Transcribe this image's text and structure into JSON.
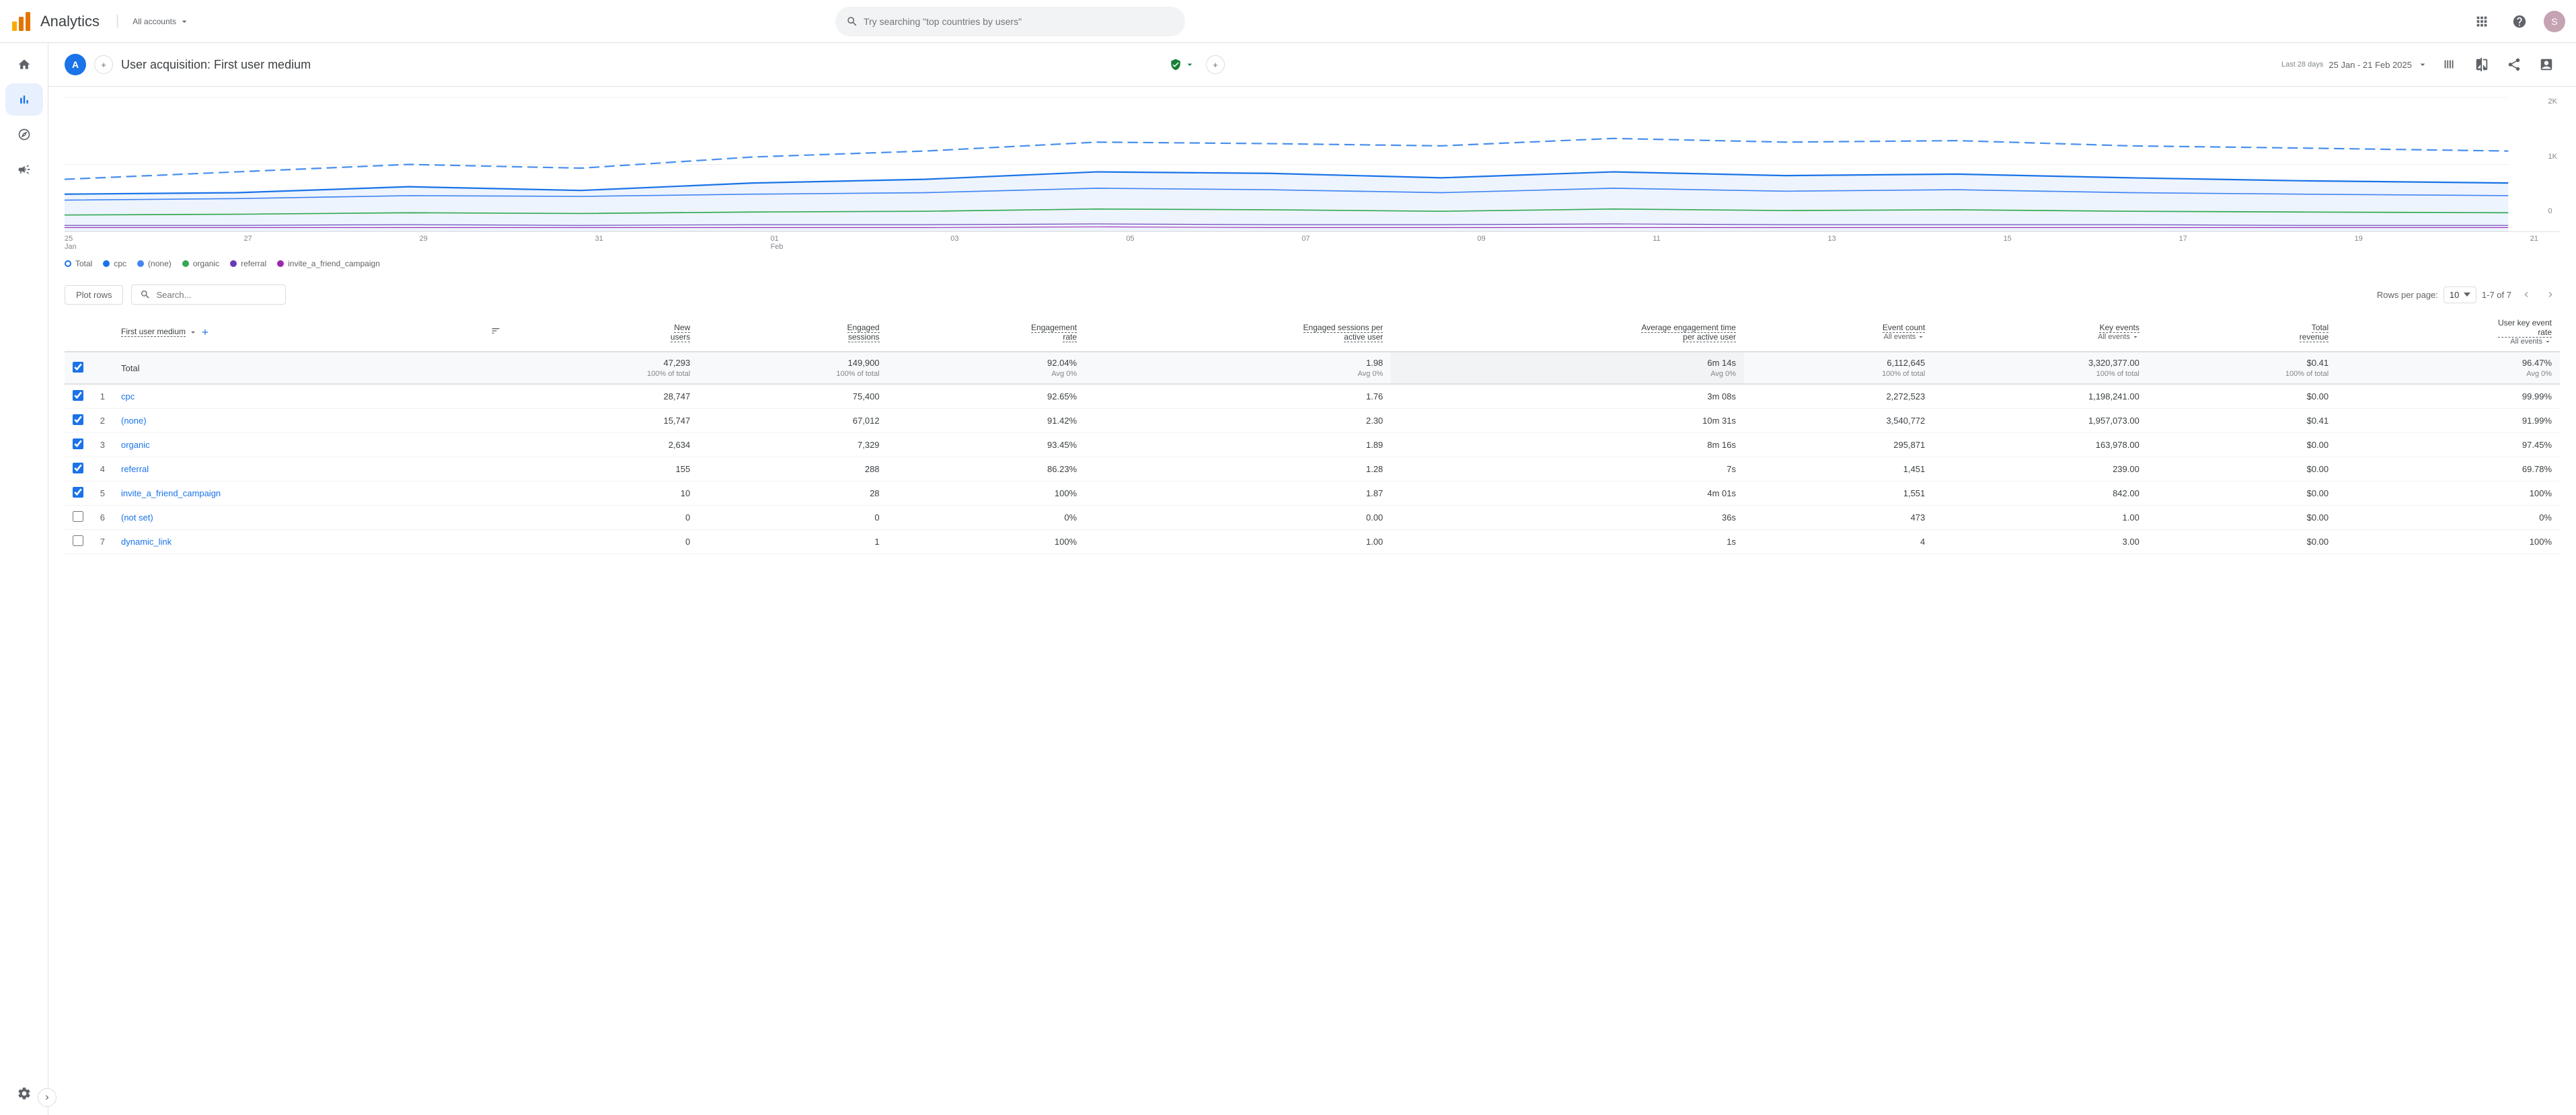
{
  "app": {
    "title": "Analytics",
    "account": "All accounts",
    "search_placeholder": "Try searching \"top countries by users\""
  },
  "header": {
    "page_title": "User acquisition: First user medium",
    "date_label": "Last 28 days",
    "date_range": "25 Jan - 21 Feb 2025",
    "property_initial": "A"
  },
  "sidebar": {
    "items": [
      {
        "label": "Home",
        "icon": "home"
      },
      {
        "label": "Reports",
        "icon": "bar-chart",
        "active": true
      },
      {
        "label": "Explore",
        "icon": "compass"
      },
      {
        "label": "Advertising",
        "icon": "megaphone"
      }
    ]
  },
  "chart": {
    "y_labels": [
      "2K",
      "1K",
      "0"
    ],
    "x_labels": [
      {
        "date": "25",
        "month": "Jan"
      },
      {
        "date": "27",
        "month": ""
      },
      {
        "date": "29",
        "month": ""
      },
      {
        "date": "31",
        "month": ""
      },
      {
        "date": "01",
        "month": "Feb"
      },
      {
        "date": "03",
        "month": ""
      },
      {
        "date": "05",
        "month": ""
      },
      {
        "date": "07",
        "month": ""
      },
      {
        "date": "09",
        "month": ""
      },
      {
        "date": "11",
        "month": ""
      },
      {
        "date": "13",
        "month": ""
      },
      {
        "date": "15",
        "month": ""
      },
      {
        "date": "17",
        "month": ""
      },
      {
        "date": "19",
        "month": ""
      },
      {
        "date": "21",
        "month": ""
      }
    ],
    "legend": [
      {
        "label": "Total",
        "color": "#1a73e8",
        "type": "hollow-circle"
      },
      {
        "label": "cpc",
        "color": "#1a73e8",
        "type": "dot"
      },
      {
        "label": "(none)",
        "color": "#4285f4",
        "type": "dot"
      },
      {
        "label": "organic",
        "color": "#34a853",
        "type": "dot"
      },
      {
        "label": "referral",
        "color": "#673ab7",
        "type": "dot"
      },
      {
        "label": "invite_a_friend_campaign",
        "color": "#9c27b0",
        "type": "dot"
      }
    ]
  },
  "table": {
    "plot_rows_label": "Plot rows",
    "search_placeholder": "Search...",
    "rows_per_page_label": "Rows per page:",
    "rows_per_page_value": "10",
    "pagination": "1-7 of 7",
    "columns": [
      {
        "label": "First user medium",
        "key": "medium",
        "align": "left"
      },
      {
        "label": "New users",
        "key": "new_users",
        "align": "right"
      },
      {
        "label": "Engaged sessions",
        "key": "engaged_sessions",
        "align": "right"
      },
      {
        "label": "Engagement rate",
        "key": "engagement_rate",
        "align": "right"
      },
      {
        "label": "Engaged sessions per active user",
        "key": "engaged_per_user",
        "align": "right"
      },
      {
        "label": "Average engagement time per active user",
        "key": "avg_engagement",
        "align": "right"
      },
      {
        "label": "Event count",
        "key": "event_count",
        "filter": "All events",
        "align": "right"
      },
      {
        "label": "Key events",
        "key": "key_events",
        "filter": "All events",
        "align": "right"
      },
      {
        "label": "Total revenue",
        "key": "total_revenue",
        "align": "right"
      },
      {
        "label": "User key event rate",
        "key": "user_key_event_rate",
        "filter": "All events",
        "align": "right"
      }
    ],
    "total_row": {
      "label": "Total",
      "checked": true,
      "new_users": "47,293",
      "new_users_sub": "100% of total",
      "engaged_sessions": "149,900",
      "engaged_sessions_sub": "100% of total",
      "engagement_rate": "92.04%",
      "engagement_rate_sub": "Avg 0%",
      "engaged_per_user": "1.98",
      "engaged_per_user_sub": "Avg 0%",
      "avg_engagement": "6m 14s",
      "avg_engagement_sub": "Avg 0%",
      "event_count": "6,112,645",
      "event_count_sub": "100% of total",
      "key_events": "3,320,377.00",
      "key_events_sub": "100% of total",
      "total_revenue": "$0.41",
      "total_revenue_sub": "100% of total",
      "user_key_event_rate": "96.47%",
      "user_key_event_rate_sub": "Avg 0%"
    },
    "rows": [
      {
        "rank": "1",
        "medium": "cpc",
        "checked": true,
        "new_users": "28,747",
        "engaged_sessions": "75,400",
        "engagement_rate": "92.65%",
        "engaged_per_user": "1.76",
        "avg_engagement": "3m 08s",
        "event_count": "2,272,523",
        "key_events": "1,198,241.00",
        "total_revenue": "$0.00",
        "user_key_event_rate": "99.99%"
      },
      {
        "rank": "2",
        "medium": "(none)",
        "checked": true,
        "new_users": "15,747",
        "engaged_sessions": "67,012",
        "engagement_rate": "91.42%",
        "engaged_per_user": "2.30",
        "avg_engagement": "10m 31s",
        "event_count": "3,540,772",
        "key_events": "1,957,073.00",
        "total_revenue": "$0.41",
        "user_key_event_rate": "91.99%"
      },
      {
        "rank": "3",
        "medium": "organic",
        "checked": true,
        "new_users": "2,634",
        "engaged_sessions": "7,329",
        "engagement_rate": "93.45%",
        "engaged_per_user": "1.89",
        "avg_engagement": "8m 16s",
        "event_count": "295,871",
        "key_events": "163,978.00",
        "total_revenue": "$0.00",
        "user_key_event_rate": "97.45%"
      },
      {
        "rank": "4",
        "medium": "referral",
        "checked": true,
        "new_users": "155",
        "engaged_sessions": "288",
        "engagement_rate": "86.23%",
        "engaged_per_user": "1.28",
        "avg_engagement": "7s",
        "event_count": "1,451",
        "key_events": "239.00",
        "total_revenue": "$0.00",
        "user_key_event_rate": "69.78%"
      },
      {
        "rank": "5",
        "medium": "invite_a_friend_campaign",
        "checked": true,
        "new_users": "10",
        "engaged_sessions": "28",
        "engagement_rate": "100%",
        "engaged_per_user": "1.87",
        "avg_engagement": "4m 01s",
        "event_count": "1,551",
        "key_events": "842.00",
        "total_revenue": "$0.00",
        "user_key_event_rate": "100%"
      },
      {
        "rank": "6",
        "medium": "(not set)",
        "checked": false,
        "new_users": "0",
        "engaged_sessions": "0",
        "engagement_rate": "0%",
        "engaged_per_user": "0.00",
        "avg_engagement": "36s",
        "event_count": "473",
        "key_events": "1.00",
        "total_revenue": "$0.00",
        "user_key_event_rate": "0%"
      },
      {
        "rank": "7",
        "medium": "dynamic_link",
        "checked": false,
        "new_users": "0",
        "engaged_sessions": "1",
        "engagement_rate": "100%",
        "engaged_per_user": "1.00",
        "avg_engagement": "1s",
        "event_count": "4",
        "key_events": "3.00",
        "total_revenue": "$0.00",
        "user_key_event_rate": "100%"
      }
    ]
  }
}
